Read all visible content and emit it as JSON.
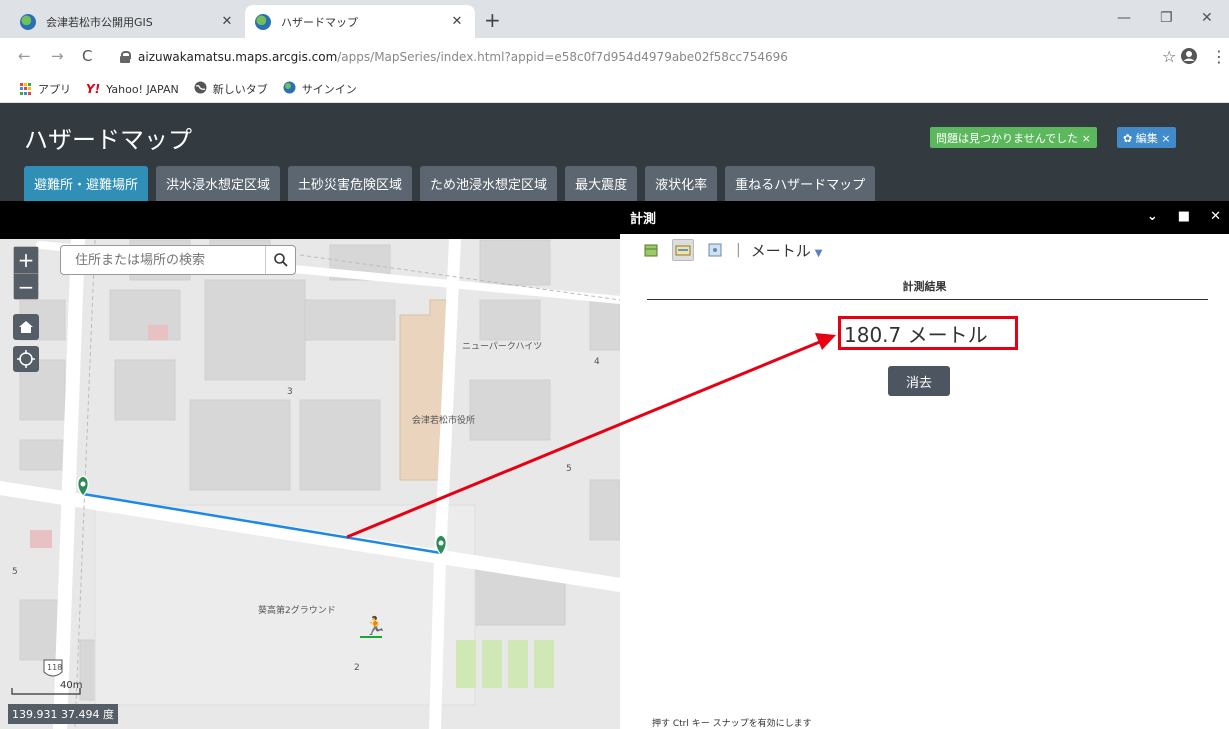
{
  "browser": {
    "tabs": [
      {
        "title": "会津若松市公開用GIS",
        "active": false
      },
      {
        "title": "ハザードマップ",
        "active": true
      }
    ],
    "url_host": "aizuwakamatsu.maps.arcgis.com",
    "url_path": "/apps/MapSeries/index.html?appid=e58c0f7d954d4979abe02f58cc754696",
    "bookmarks": [
      {
        "label": "アプリ",
        "icon": "apps-grid-icon"
      },
      {
        "label": "Yahoo! JAPAN",
        "icon": "yahoo-icon"
      },
      {
        "label": "新しいタブ",
        "icon": "globe-icon"
      },
      {
        "label": "サインイン",
        "icon": "arcgis-icon"
      }
    ]
  },
  "app": {
    "title": "ハザードマップ",
    "status_badge": "問題は見つかりませんでした ×",
    "edit_badge": "✿ 編集 ×",
    "tabs": [
      {
        "label": "避難所・避難場所",
        "active": true
      },
      {
        "label": "洪水浸水想定区域",
        "active": false
      },
      {
        "label": "土砂災害危険区域",
        "active": false
      },
      {
        "label": "ため池浸水想定区域",
        "active": false
      },
      {
        "label": "最大震度",
        "active": false
      },
      {
        "label": "液状化率",
        "active": false
      },
      {
        "label": "重ねるハザードマップ",
        "active": false
      }
    ]
  },
  "map": {
    "search_placeholder": "住所または場所の検索",
    "coordinates": "139.931 37.494 度",
    "scale_label": "40m",
    "labels": {
      "apartment": "ニューパークハイツ",
      "city_hall": "会津若松市役所",
      "ground": "葵高第2グラウンド",
      "block_3": "3",
      "block_4": "4",
      "block_5a": "5",
      "block_5b": "5",
      "block_2": "2",
      "route": "118"
    }
  },
  "panel": {
    "title": "計測",
    "unit": "メートル",
    "result_header": "計測結果",
    "result_value": "180.7 メートル",
    "clear_label": "消去",
    "hint": "押す Ctrl キー スナップを有効にします"
  }
}
